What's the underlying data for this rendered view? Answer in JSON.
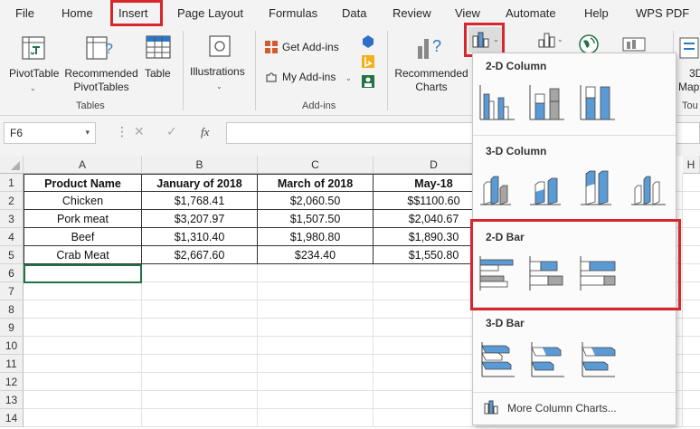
{
  "menu": {
    "tabs": [
      "File",
      "Home",
      "Insert",
      "Page Layout",
      "Formulas",
      "Data",
      "Review",
      "View",
      "Automate",
      "Help",
      "WPS PDF"
    ]
  },
  "ribbon": {
    "pivot_table": "PivotTable",
    "recommended_pivot_line1": "Recommended",
    "recommended_pivot_line2": "PivotTables",
    "table": "Table",
    "tables_group": "Tables",
    "illustrations": "Illustrations",
    "get_addins": "Get Add-ins",
    "my_addins": "My Add-ins",
    "addins_group": "Add-ins",
    "recommended_charts_line1": "Recommended",
    "recommended_charts_line2": "Charts",
    "maps_partial": "3D",
    "maps_partial2": "Map",
    "tours_partial": "Tou"
  },
  "formula_bar": {
    "name_box": "F6",
    "fx": "fx"
  },
  "sheet": {
    "columns": [
      "A",
      "B",
      "C",
      "D",
      "H"
    ],
    "row_numbers": [
      "1",
      "2",
      "3",
      "4",
      "5",
      "6",
      "7",
      "8",
      "9",
      "10",
      "11",
      "12",
      "13",
      "14"
    ],
    "header_row": [
      "Product Name",
      "January of 2018",
      "March of 2018",
      "May-18"
    ],
    "rows": [
      [
        "Chicken",
        "$1,768.41",
        "$2,060.50",
        "$$1100.60"
      ],
      [
        "Pork meat",
        "$3,207.97",
        "$1,507.50",
        "$2,040.67"
      ],
      [
        "Beef",
        "$1,310.40",
        "$1,980.80",
        "$1,890.30"
      ],
      [
        "Crab Meat",
        "$2,667.60",
        "$234.40",
        "$1,550.80"
      ]
    ]
  },
  "chart_panel": {
    "section_2d_column": "2-D Column",
    "section_3d_column": "3-D Column",
    "section_2d_bar": "2-D Bar",
    "section_3d_bar": "3-D Bar",
    "more_link": "More Column Charts..."
  },
  "colors": {
    "accent_red": "#d9262c",
    "chart_blue": "#5b9bd5",
    "chart_gray": "#a5a5a5",
    "excel_green": "#217346"
  }
}
